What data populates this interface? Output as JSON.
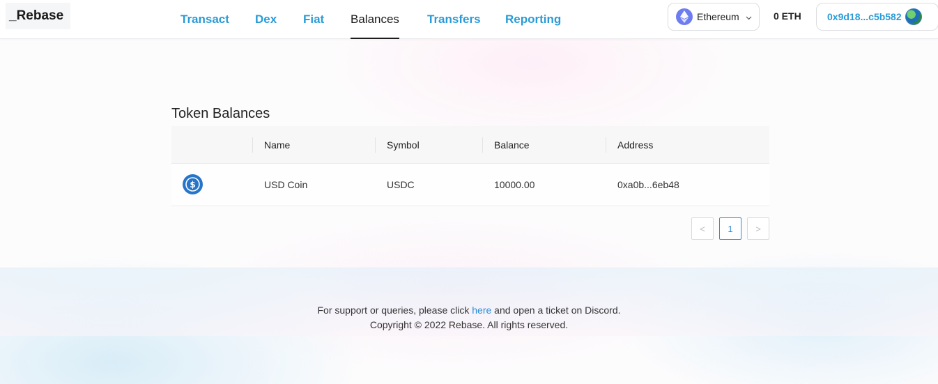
{
  "brand": {
    "logo_text": "_Rebase"
  },
  "nav": {
    "items": [
      {
        "label": "Transact"
      },
      {
        "label": "Dex"
      },
      {
        "label": "Fiat"
      },
      {
        "label": "Balances"
      },
      {
        "label": "Transfers"
      },
      {
        "label": "Reporting"
      }
    ],
    "active": "Balances"
  },
  "wallet": {
    "network_label": "Ethereum",
    "network_icon": "ethereum-icon",
    "eth_balance": "0 ETH",
    "account_address": "0x9d18...c5b582"
  },
  "balances": {
    "title": "Token Balances",
    "columns": [
      "",
      "Name",
      "Symbol",
      "Balance",
      "Address"
    ],
    "rows": [
      {
        "icon": "usdc-icon",
        "name": "USD Coin",
        "symbol": "USDC",
        "balance": "10000.00",
        "address": "0xa0b...6eb48"
      }
    ],
    "pagination": {
      "prev": "<",
      "current_page": "1",
      "next": ">"
    }
  },
  "footer": {
    "support_before": "For support or queries, please click ",
    "support_link": "here",
    "support_after": " and open a ticket on Discord.",
    "copyright": "Copyright © 2022 Rebase. All rights reserved."
  },
  "colors": {
    "accent": "#2a9bd6",
    "usdc": "#2775ca",
    "ethereum": "#6d7cf0"
  }
}
